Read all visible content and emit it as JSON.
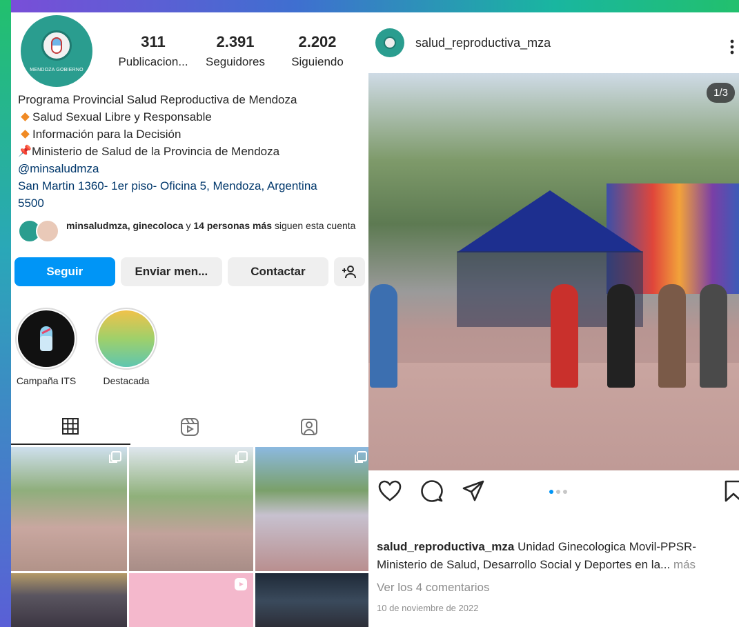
{
  "profile": {
    "avatar_text": "MENDOZA GOBIERNO",
    "stats": [
      {
        "value": "311",
        "label": "Publicacion..."
      },
      {
        "value": "2.391",
        "label": "Seguidores"
      },
      {
        "value": "2.202",
        "label": "Siguiendo"
      }
    ],
    "bio": {
      "name": "Programa Provincial Salud Reproductiva de Mendoza",
      "line1": "Salud Sexual Libre y Responsable",
      "line2": "Información para la Decisión",
      "line3": "Ministerio de Salud de la Provincia de Mendoza",
      "mention": "@minsaludmza",
      "address": "San Martin 1360- 1er piso- Oficina 5, Mendoza, Argentina",
      "postal": "5500"
    },
    "followed_by": {
      "names": "minsaludmza, ginecoloca",
      "connector": " y ",
      "others": "14 personas más",
      "suffix": " siguen esta cuenta"
    },
    "buttons": {
      "follow": "Seguir",
      "message": "Enviar men...",
      "contact": "Contactar"
    },
    "highlights": [
      {
        "label": "Campaña ITS"
      },
      {
        "label": "Destacada"
      }
    ]
  },
  "post": {
    "username": "salud_reproductiva_mza",
    "counter": "1/3",
    "carousel": {
      "total": 3,
      "active": 1
    },
    "caption_user": "salud_reproductiva_mza",
    "caption_text": "Unidad Ginecologica Movil-PPSR- Ministerio de Salud, Desarrollo Social y Deportes en la...",
    "caption_more": "más",
    "comments": "Ver los 4 comentarios",
    "date": "10 de noviembre de 2022"
  },
  "colors": {
    "accent": "#0095f6",
    "brand_teal": "#2a9d8f",
    "link": "#00376b",
    "muted": "#8e8e8e"
  }
}
